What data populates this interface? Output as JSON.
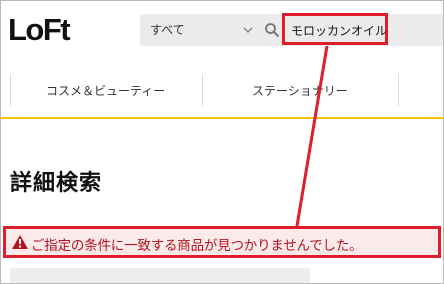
{
  "header": {
    "logo_text": "LoFt",
    "search": {
      "category": "すべて",
      "query": "モロッカンオイル"
    }
  },
  "nav": {
    "items": [
      {
        "label": "コスメ＆ビューティー"
      },
      {
        "label": "ステーショナリー"
      }
    ]
  },
  "main": {
    "title": "詳細検索",
    "alert": "ご指定の条件に一致する商品が見つかりませんでした。"
  },
  "colors": {
    "annotation_red": "#e01e2b",
    "accent_yellow": "#f5c400",
    "alert_text": "#b3141f"
  }
}
